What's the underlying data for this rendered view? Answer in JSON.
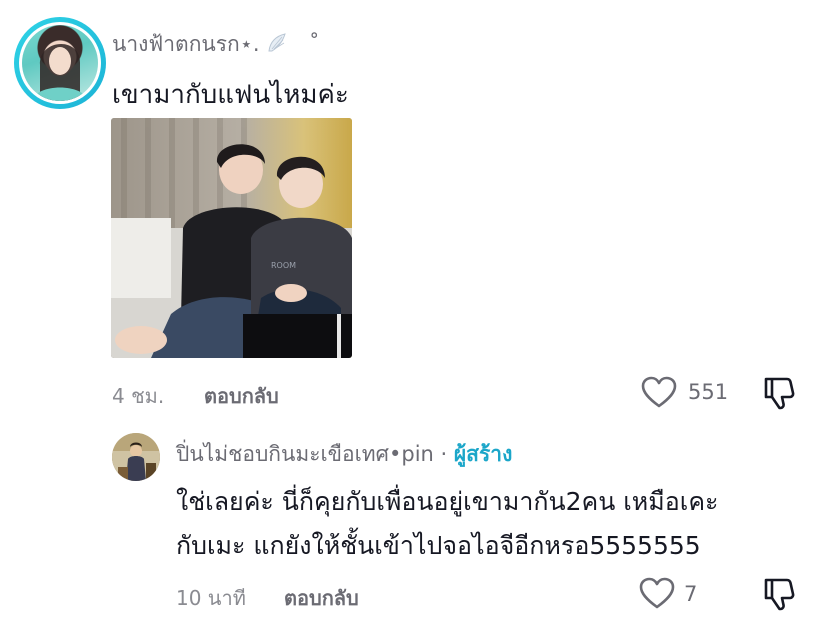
{
  "comment": {
    "username": "นางฟ้าตกนรก⋆.",
    "username_suffix": "˚",
    "text": "เขามากับแฟนไหมค่ะ",
    "time": "4 ชม.",
    "reply_label": "ตอบกลับ",
    "like_count": "551",
    "avatar_icon": "profile-avatar",
    "media_icon": "photo-thumbnail"
  },
  "reply": {
    "username": "ปิ่นไม่ชอบกินมะเขือเทศ•pin",
    "separator": " · ",
    "creator_badge": "ผู้สร้าง",
    "text_line1": "ใช่เลยค่ะ นี่ก็คุยกับเพื่อนอยู่เขามากัน2คน เหมือเคะ",
    "text_line2": "กับเมะ แกยังให้ชั้นเข้าไปจอไอจีอีกหรอ5555555",
    "time": "10 นาที",
    "reply_label": "ตอบกลับ",
    "like_count": "7"
  },
  "colors": {
    "accent": "#1ba6c9",
    "ring": "#2fd3e6",
    "text_primary": "#161823",
    "text_secondary": "#6b6b73"
  }
}
